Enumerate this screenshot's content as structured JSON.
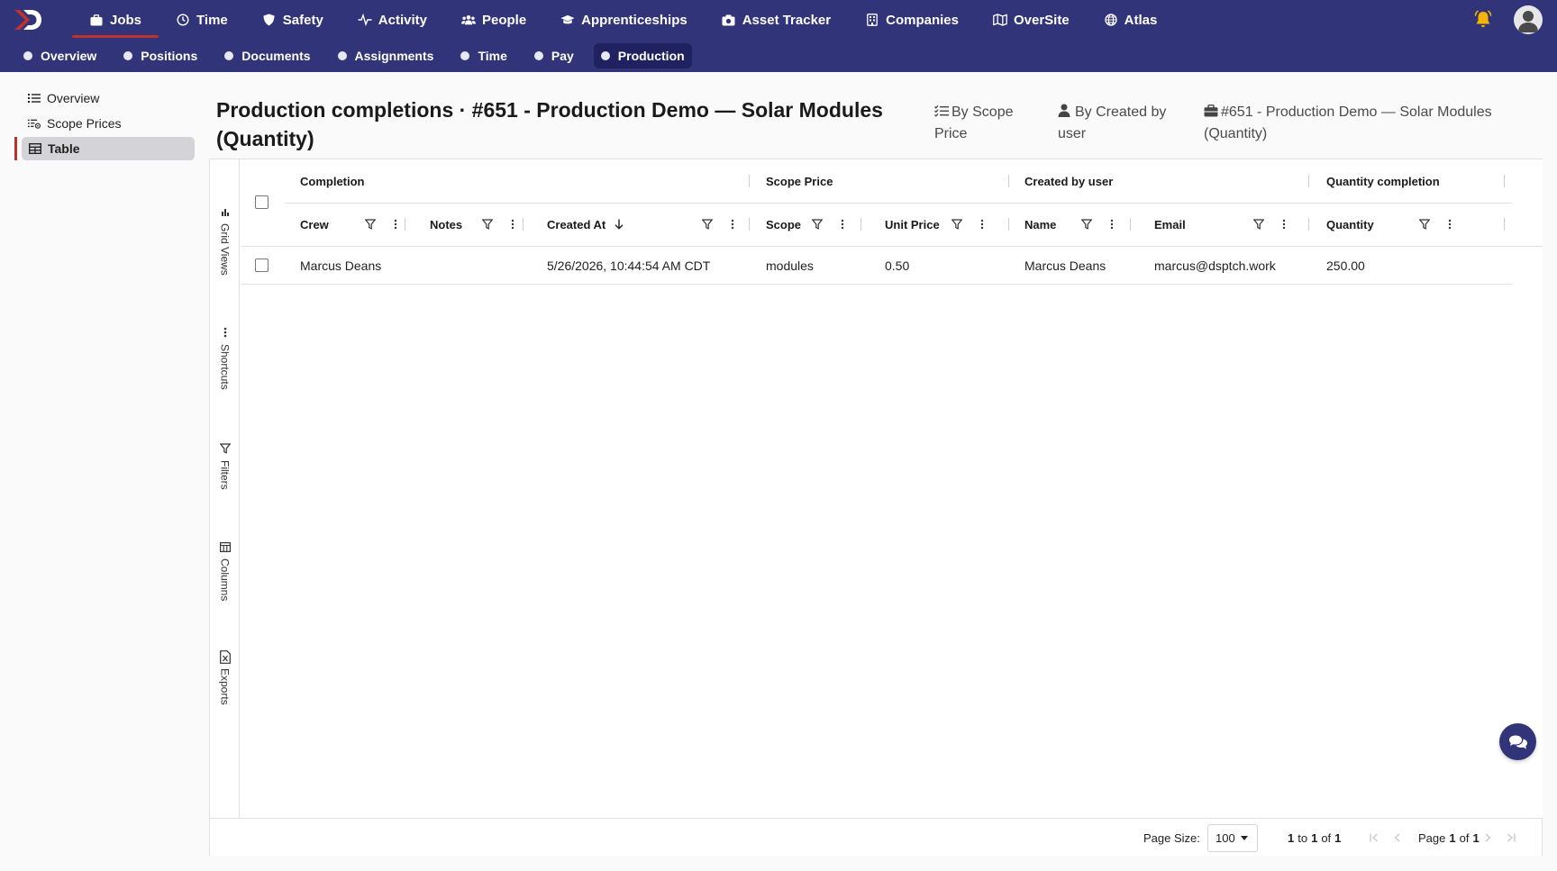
{
  "top_nav": {
    "items": [
      {
        "label": "Jobs",
        "icon": "briefcase-icon"
      },
      {
        "label": "Time",
        "icon": "clock-icon"
      },
      {
        "label": "Safety",
        "icon": "shield-icon"
      },
      {
        "label": "Activity",
        "icon": "activity-icon"
      },
      {
        "label": "People",
        "icon": "people-icon"
      },
      {
        "label": "Apprenticeships",
        "icon": "graduation-cap-icon"
      },
      {
        "label": "Asset Tracker",
        "icon": "camera-icon"
      },
      {
        "label": "Companies",
        "icon": "building-icon"
      },
      {
        "label": "OverSite",
        "icon": "map-icon"
      },
      {
        "label": "Atlas",
        "icon": "globe-icon"
      }
    ],
    "active": "Jobs"
  },
  "sub_nav": {
    "items": [
      "Overview",
      "Positions",
      "Documents",
      "Assignments",
      "Time",
      "Pay",
      "Production"
    ],
    "active": "Production"
  },
  "left_menu": {
    "items": [
      {
        "label": "Overview",
        "icon": "list-icon"
      },
      {
        "label": "Scope Prices",
        "icon": "list-settings-icon"
      },
      {
        "label": "Table",
        "icon": "table-icon"
      }
    ],
    "active": "Table"
  },
  "header": {
    "title": "Production completions · #651 - Production Demo — Solar Modules (Quantity)",
    "group_by_scope_line1": "By Scope",
    "group_by_scope_line2": "Price",
    "group_by_user_line1": "By Created by",
    "group_by_user_line2": "user",
    "job_line1": "#651 - Production Demo — Solar Modules",
    "job_line2": "(Quantity)"
  },
  "side_rail": [
    "Grid Views",
    "Shortcuts",
    "Filters",
    "Columns",
    "Exports"
  ],
  "grid": {
    "groups": [
      "Completion",
      "Scope Price",
      "Created by user",
      "Quantity completion"
    ],
    "columns": [
      "Crew",
      "Notes",
      "Created At",
      "Scope",
      "Unit Price",
      "Name",
      "Email",
      "Quantity"
    ],
    "sorted_column": "Created At",
    "sort_direction": "descending",
    "rows": [
      {
        "crew": "Marcus Deans",
        "notes": "",
        "created_at": "5/26/2026, 10:44:54 AM CDT",
        "scope": "modules",
        "unit_price": "0.50",
        "name": "Marcus Deans",
        "email": "marcus@dsptch.work",
        "quantity": "250.00"
      }
    ]
  },
  "footer": {
    "page_size_label": "Page Size:",
    "page_size_value": "100",
    "range_from": "1",
    "range_to_word": "to",
    "range_to": "1",
    "range_of_word": "of",
    "range_total": "1",
    "page_word": "Page",
    "page_current": "1",
    "page_of_word": "of",
    "page_total": "1"
  },
  "colors": {
    "nav_bg": "#313478",
    "active_accent": "#c0322e",
    "bell": "#f5b400"
  }
}
